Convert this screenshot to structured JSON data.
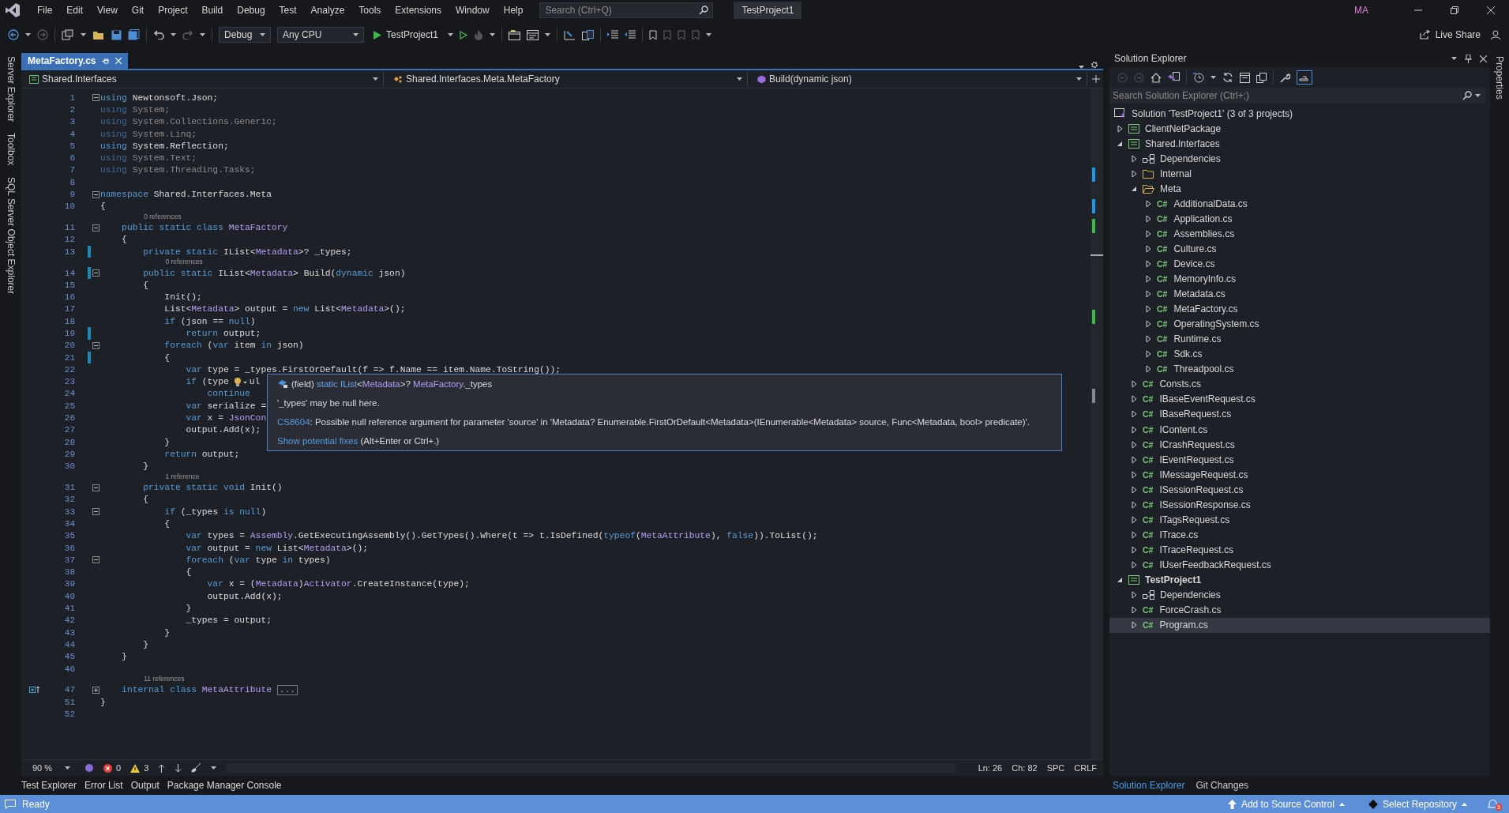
{
  "menu": [
    "File",
    "Edit",
    "View",
    "Git",
    "Project",
    "Build",
    "Debug",
    "Test",
    "Analyze",
    "Tools",
    "Extensions",
    "Window",
    "Help"
  ],
  "search": {
    "placeholder": "Search (Ctrl+Q)"
  },
  "solution_title": "TestProject1",
  "user_initials": "MA",
  "toolbar": {
    "configuration": "Debug",
    "platform": "Any CPU",
    "start_target": "TestProject1",
    "live_share": "Live Share"
  },
  "left_side_tabs": [
    "Server Explorer",
    "Toolbox",
    "SQL Server Object Explorer"
  ],
  "right_side_tabs": [
    "Properties"
  ],
  "document_tab": {
    "title": "MetaFactory.cs",
    "selected": true
  },
  "navigation": [
    "Shared.Interfaces",
    "Shared.Interfaces.Meta.MetaFactory",
    "Build(dynamic json)"
  ],
  "code_lines": [
    {
      "number": "1",
      "fold": {
        "expanded": true
      },
      "changed": false,
      "tokens": [
        {
          "text": "using",
          "kind": "kw"
        },
        {
          "text": " Newtonsoft.Json;",
          "kind": "tx"
        }
      ]
    },
    {
      "number": "2",
      "changed": false,
      "tokens": [
        {
          "text": "using",
          "kind": "kwd"
        },
        {
          "text": " System;",
          "kind": "dim"
        }
      ]
    },
    {
      "number": "3",
      "changed": false,
      "tokens": [
        {
          "text": "using",
          "kind": "kwd"
        },
        {
          "text": " System.Collections.Generic;",
          "kind": "dim"
        }
      ]
    },
    {
      "number": "4",
      "changed": false,
      "tokens": [
        {
          "text": "using",
          "kind": "kwd"
        },
        {
          "text": " System.Linq;",
          "kind": "dim"
        }
      ]
    },
    {
      "number": "5",
      "changed": false,
      "tokens": [
        {
          "text": "using",
          "kind": "kw"
        },
        {
          "text": " System.Reflection;",
          "kind": "tx"
        }
      ]
    },
    {
      "number": "6",
      "changed": false,
      "tokens": [
        {
          "text": "using",
          "kind": "kwd"
        },
        {
          "text": " System.Text;",
          "kind": "dim"
        }
      ]
    },
    {
      "number": "7",
      "changed": false,
      "tokens": [
        {
          "text": "using",
          "kind": "kwd"
        },
        {
          "text": " System.Threading.Tasks;",
          "kind": "dim"
        }
      ]
    },
    {
      "number": "8",
      "changed": false
    },
    {
      "number": "9",
      "fold": {
        "expanded": true
      },
      "changed": false,
      "tokens": [
        {
          "text": "namespace",
          "kind": "kw"
        },
        {
          "text": " Shared.Interfaces.Meta",
          "kind": "tx"
        }
      ]
    },
    {
      "number": "10",
      "changed": false,
      "tokens": [
        {
          "text": "{",
          "kind": "tx"
        }
      ]
    },
    {
      "number": "11",
      "fold": {
        "expanded": true
      },
      "changed": false,
      "lens": "0 references",
      "tokens": [
        {
          "text": "    public static class ",
          "kind": "kw"
        },
        {
          "text": "MetaFactory",
          "kind": "ty"
        }
      ]
    },
    {
      "number": "12",
      "changed": false,
      "tokens": [
        {
          "text": "    {",
          "kind": "tx"
        }
      ]
    },
    {
      "number": "13",
      "changed": true,
      "tokens": [
        {
          "text": "        private static",
          "kind": "kw"
        },
        {
          "text": " IList<",
          "kind": "tx"
        },
        {
          "text": "Metadata",
          "kind": "ty"
        },
        {
          "text": ">? _types;",
          "kind": "tx"
        }
      ]
    },
    {
      "number": "14",
      "fold": {
        "expanded": true
      },
      "changed": true,
      "lens": "0 references",
      "tokens": [
        {
          "text": "        public static",
          "kind": "kw"
        },
        {
          "text": " IList<",
          "kind": "tx"
        },
        {
          "text": "Metadata",
          "kind": "ty"
        },
        {
          "text": "> Build(",
          "kind": "tx"
        },
        {
          "text": "dynamic",
          "kind": "kw"
        },
        {
          "text": " json)",
          "kind": "tx"
        }
      ]
    },
    {
      "number": "15",
      "changed": false,
      "tokens": [
        {
          "text": "        {",
          "kind": "tx"
        }
      ]
    },
    {
      "number": "16",
      "changed": false,
      "tokens": [
        {
          "text": "            Init();",
          "kind": "tx"
        }
      ]
    },
    {
      "number": "17",
      "changed": false,
      "tokens": [
        {
          "text": "            List<",
          "kind": "tx"
        },
        {
          "text": "Metadata",
          "kind": "ty"
        },
        {
          "text": "> output = ",
          "kind": "tx"
        },
        {
          "text": "new",
          "kind": "kw"
        },
        {
          "text": " List<",
          "kind": "tx"
        },
        {
          "text": "Metadata",
          "kind": "ty"
        },
        {
          "text": ">();",
          "kind": "tx"
        }
      ]
    },
    {
      "number": "18",
      "changed": false,
      "tokens": [
        {
          "text": "            if",
          "kind": "kw"
        },
        {
          "text": " (json == ",
          "kind": "tx"
        },
        {
          "text": "null",
          "kind": "kw"
        },
        {
          "text": ")",
          "kind": "tx"
        }
      ]
    },
    {
      "number": "19",
      "changed": true,
      "tokens": [
        {
          "text": "                return",
          "kind": "kw"
        },
        {
          "text": " output;",
          "kind": "tx"
        }
      ]
    },
    {
      "number": "20",
      "fold": {
        "expanded": true
      },
      "changed": false,
      "tokens": [
        {
          "text": "            foreach",
          "kind": "kw"
        },
        {
          "text": " (",
          "kind": "tx"
        },
        {
          "text": "var",
          "kind": "kw"
        },
        {
          "text": " item ",
          "kind": "tx"
        },
        {
          "text": "in",
          "kind": "kw"
        },
        {
          "text": " json)",
          "kind": "tx"
        }
      ]
    },
    {
      "number": "21",
      "changed": true,
      "tokens": [
        {
          "text": "            {",
          "kind": "tx"
        }
      ]
    },
    {
      "number": "22",
      "changed": false,
      "tokens": [
        {
          "text": "                var",
          "kind": "kw"
        },
        {
          "text": " type = _types.FirstOrDefault(f => f.Name == item.Name.ToString());",
          "kind": "tx"
        }
      ]
    },
    {
      "number": "23",
      "changed": false,
      "tokens": [
        {
          "text": "                if",
          "kind": "kw"
        },
        {
          "text": " (type",
          "kind": "tx"
        },
        {
          "kind": "bulb"
        },
        {
          "text": "ul",
          "kind": "tx"
        }
      ]
    },
    {
      "number": "24",
      "changed": false,
      "tokens": [
        {
          "text": "                    continue",
          "kind": "kw"
        }
      ]
    },
    {
      "number": "25",
      "changed": false,
      "tokens": [
        {
          "text": "                var",
          "kind": "kw"
        },
        {
          "text": " serialize =",
          "kind": "tx"
        }
      ]
    },
    {
      "number": "26",
      "changed": false,
      "tokens": [
        {
          "text": "                var",
          "kind": "kw"
        },
        {
          "text": " x = ",
          "kind": "tx"
        },
        {
          "text": "JsonCon",
          "kind": "ty"
        }
      ]
    },
    {
      "number": "27",
      "changed": false,
      "tokens": [
        {
          "text": "                output.Add(x);",
          "kind": "tx"
        }
      ]
    },
    {
      "number": "28",
      "changed": false,
      "tokens": [
        {
          "text": "            }",
          "kind": "tx"
        }
      ]
    },
    {
      "number": "29",
      "changed": false,
      "tokens": [
        {
          "text": "            return",
          "kind": "kw"
        },
        {
          "text": " output;",
          "kind": "tx"
        }
      ]
    },
    {
      "number": "30",
      "changed": false,
      "tokens": [
        {
          "text": "        }",
          "kind": "tx"
        }
      ]
    },
    {
      "number": "31",
      "fold": {
        "expanded": true
      },
      "changed": false,
      "lens": "1 reference",
      "tokens": [
        {
          "text": "        private static void",
          "kind": "kw"
        },
        {
          "text": " Init()",
          "kind": "tx"
        }
      ]
    },
    {
      "number": "32",
      "changed": false,
      "tokens": [
        {
          "text": "        {",
          "kind": "tx"
        }
      ]
    },
    {
      "number": "33",
      "fold": {
        "expanded": true
      },
      "changed": false,
      "tokens": [
        {
          "text": "            if",
          "kind": "kw"
        },
        {
          "text": " (_types ",
          "kind": "tx"
        },
        {
          "text": "is null",
          "kind": "kw"
        },
        {
          "text": ")",
          "kind": "tx"
        }
      ]
    },
    {
      "number": "34",
      "changed": false,
      "tokens": [
        {
          "text": "            {",
          "kind": "tx"
        }
      ]
    },
    {
      "number": "35",
      "changed": false,
      "tokens": [
        {
          "text": "                var",
          "kind": "kw"
        },
        {
          "text": " types = ",
          "kind": "tx"
        },
        {
          "text": "Assembly",
          "kind": "ty"
        },
        {
          "text": ".GetExecutingAssembly().GetTypes().Where(t => t.IsDefined(",
          "kind": "tx"
        },
        {
          "text": "typeof",
          "kind": "kw"
        },
        {
          "text": "(",
          "kind": "tx"
        },
        {
          "text": "MetaAttribute",
          "kind": "ty"
        },
        {
          "text": "), ",
          "kind": "tx"
        },
        {
          "text": "false",
          "kind": "kw"
        },
        {
          "text": ")).ToList();",
          "kind": "tx"
        }
      ]
    },
    {
      "number": "36",
      "changed": false,
      "tokens": [
        {
          "text": "                var",
          "kind": "kw"
        },
        {
          "text": " output = ",
          "kind": "tx"
        },
        {
          "text": "new",
          "kind": "kw"
        },
        {
          "text": " List<",
          "kind": "tx"
        },
        {
          "text": "Metadata",
          "kind": "ty"
        },
        {
          "text": ">();",
          "kind": "tx"
        }
      ]
    },
    {
      "number": "37",
      "fold": {
        "expanded": true
      },
      "changed": false,
      "tokens": [
        {
          "text": "                foreach",
          "kind": "kw"
        },
        {
          "text": " (",
          "kind": "tx"
        },
        {
          "text": "var",
          "kind": "kw"
        },
        {
          "text": " type ",
          "kind": "tx"
        },
        {
          "text": "in",
          "kind": "kw"
        },
        {
          "text": " types)",
          "kind": "tx"
        }
      ]
    },
    {
      "number": "38",
      "changed": false,
      "tokens": [
        {
          "text": "                {",
          "kind": "tx"
        }
      ]
    },
    {
      "number": "39",
      "changed": false,
      "tokens": [
        {
          "text": "                    var",
          "kind": "kw"
        },
        {
          "text": " x = (",
          "kind": "tx"
        },
        {
          "text": "Metadata",
          "kind": "ty"
        },
        {
          "text": ")",
          "kind": "tx"
        },
        {
          "text": "Activator",
          "kind": "ty"
        },
        {
          "text": ".CreateInstance(type);",
          "kind": "tx"
        }
      ]
    },
    {
      "number": "40",
      "changed": false,
      "tokens": [
        {
          "text": "                    output.Add(x);",
          "kind": "tx"
        }
      ]
    },
    {
      "number": "41",
      "changed": false,
      "tokens": [
        {
          "text": "                }",
          "kind": "tx"
        }
      ]
    },
    {
      "number": "42",
      "changed": false,
      "tokens": [
        {
          "text": "                _types = output;",
          "kind": "tx"
        }
      ]
    },
    {
      "number": "43",
      "changed": false,
      "tokens": [
        {
          "text": "            }",
          "kind": "tx"
        }
      ]
    },
    {
      "number": "44",
      "changed": false,
      "tokens": [
        {
          "text": "        }",
          "kind": "tx"
        }
      ]
    },
    {
      "number": "45",
      "changed": false,
      "tokens": [
        {
          "text": "    }",
          "kind": "tx"
        }
      ]
    },
    {
      "number": "46",
      "changed": false
    },
    {
      "number": "47",
      "fold": {
        "expanded": false
      },
      "changed": false,
      "lens": "11 references",
      "glyph": {
        "kind": "implementation"
      },
      "tokens": [
        {
          "text": "    internal class ",
          "kind": "kw"
        },
        {
          "text": "MetaAttribute",
          "kind": "ty"
        },
        {
          "text": "...",
          "kind": "collapsed"
        }
      ]
    },
    {
      "number": "51",
      "changed": false,
      "tokens": [
        {
          "text": "}",
          "kind": "tx"
        }
      ]
    },
    {
      "number": "52",
      "changed": false
    }
  ],
  "tooltip": {
    "signature": [
      {
        "text": "(field) ",
        "kind": "tx"
      },
      {
        "text": "static IList",
        "kind": "kw"
      },
      {
        "text": "<",
        "kind": "tx"
      },
      {
        "text": "Metadata",
        "kind": "ty"
      },
      {
        "text": ">? ",
        "kind": "tx"
      },
      {
        "text": "MetaFactory",
        "kind": "ty"
      },
      {
        "text": "._types",
        "kind": "tx"
      }
    ],
    "message": "'_types' may be null here.",
    "error_code": "CS8604",
    "error_text": ": Possible null reference argument for parameter 'source' in 'Metadata? Enumerable.FirstOrDefault<Metadata>(IEnumerable<Metadata> source, Func<Metadata, bool> predicate)'.",
    "fix_link": "Show potential fixes",
    "fix_hint": "(Alt+Enter or Ctrl+.)"
  },
  "editor_status": {
    "zoom": "90 %",
    "errors": "0",
    "warnings": "3",
    "line": "Ln: 26",
    "column": "Ch: 82",
    "whitespace": "SPC",
    "line_ending": "CRLF"
  },
  "bottom_tabs": [
    "Test Explorer",
    "Error List",
    "Output",
    "Package Manager Console"
  ],
  "solution_explorer": {
    "title": "Solution Explorer",
    "search": {
      "placeholder": "Search Solution Explorer (Ctrl+;)"
    },
    "tree": [
      {
        "label": "Solution 'TestProject1' (3 of 3 projects)",
        "kind": "solution",
        "selected": false,
        "children": [
          {
            "label": "ClientNetPackage",
            "kind": "project",
            "startup": false,
            "expanded": false,
            "selected": false
          },
          {
            "label": "Shared.Interfaces",
            "kind": "project",
            "startup": false,
            "expanded": true,
            "selected": false,
            "children": [
              {
                "label": "Dependencies",
                "kind": "dependencies",
                "expanded": false,
                "selected": false
              },
              {
                "label": "Internal",
                "kind": "folder",
                "expanded": false,
                "selected": false
              },
              {
                "label": "Meta",
                "kind": "folder",
                "expanded": true,
                "selected": false,
                "children": [
                  {
                    "label": "AdditionalData.cs",
                    "kind": "file",
                    "badge": "C#",
                    "expanded": false,
                    "selected": false
                  },
                  {
                    "label": "Application.cs",
                    "kind": "file",
                    "badge": "C#",
                    "expanded": false,
                    "selected": false
                  },
                  {
                    "label": "Assemblies.cs",
                    "kind": "file",
                    "badge": "C#",
                    "expanded": false,
                    "selected": false
                  },
                  {
                    "label": "Culture.cs",
                    "kind": "file",
                    "badge": "C#",
                    "expanded": false,
                    "selected": false
                  },
                  {
                    "label": "Device.cs",
                    "kind": "file",
                    "badge": "C#",
                    "expanded": false,
                    "selected": false
                  },
                  {
                    "label": "MemoryInfo.cs",
                    "kind": "file",
                    "badge": "C#",
                    "expanded": false,
                    "selected": false
                  },
                  {
                    "label": "Metadata.cs",
                    "kind": "file",
                    "badge": "C#",
                    "expanded": false,
                    "selected": false
                  },
                  {
                    "label": "MetaFactory.cs",
                    "kind": "file",
                    "badge": "C#",
                    "expanded": false,
                    "selected": false
                  },
                  {
                    "label": "OperatingSystem.cs",
                    "kind": "file",
                    "badge": "C#",
                    "expanded": false,
                    "selected": false
                  },
                  {
                    "label": "Runtime.cs",
                    "kind": "file",
                    "badge": "C#",
                    "expanded": false,
                    "selected": false
                  },
                  {
                    "label": "Sdk.cs",
                    "kind": "file",
                    "badge": "C#",
                    "expanded": false,
                    "selected": false
                  },
                  {
                    "label": "Threadpool.cs",
                    "kind": "file",
                    "badge": "C#",
                    "expanded": false,
                    "selected": false
                  }
                ]
              },
              {
                "label": "Consts.cs",
                "kind": "file",
                "badge": "C#",
                "expanded": false,
                "selected": false
              },
              {
                "label": "IBaseEventRequest.cs",
                "kind": "file",
                "badge": "C#",
                "expanded": false,
                "selected": false
              },
              {
                "label": "IBaseRequest.cs",
                "kind": "file",
                "badge": "C#",
                "expanded": false,
                "selected": false
              },
              {
                "label": "IContent.cs",
                "kind": "file",
                "badge": "C#",
                "expanded": false,
                "selected": false
              },
              {
                "label": "ICrashRequest.cs",
                "kind": "file",
                "badge": "C#",
                "expanded": false,
                "selected": false
              },
              {
                "label": "IEventRequest.cs",
                "kind": "file",
                "badge": "C#",
                "expanded": false,
                "selected": false
              },
              {
                "label": "IMessageRequest.cs",
                "kind": "file",
                "badge": "C#",
                "expanded": false,
                "selected": false
              },
              {
                "label": "ISessionRequest.cs",
                "kind": "file",
                "badge": "C#",
                "expanded": false,
                "selected": false
              },
              {
                "label": "ISessionResponse.cs",
                "kind": "file",
                "badge": "C#",
                "expanded": false,
                "selected": false
              },
              {
                "label": "ITagsRequest.cs",
                "kind": "file",
                "badge": "C#",
                "expanded": false,
                "selected": false
              },
              {
                "label": "ITrace.cs",
                "kind": "file",
                "badge": "C#",
                "expanded": false,
                "selected": false
              },
              {
                "label": "ITraceRequest.cs",
                "kind": "file",
                "badge": "C#",
                "expanded": false,
                "selected": false
              },
              {
                "label": "IUserFeedbackRequest.cs",
                "kind": "file",
                "badge": "C#",
                "expanded": false,
                "selected": false
              }
            ]
          },
          {
            "label": "TestProject1",
            "kind": "project",
            "startup": true,
            "expanded": true,
            "selected": false,
            "children": [
              {
                "label": "Dependencies",
                "kind": "dependencies",
                "expanded": false,
                "selected": false
              },
              {
                "label": "ForceCrash.cs",
                "kind": "file",
                "badge": "C#",
                "expanded": false,
                "selected": false
              },
              {
                "label": "Program.cs",
                "kind": "file",
                "badge": "C#",
                "expanded": false,
                "selected": true
              }
            ]
          }
        ]
      }
    ]
  },
  "panel_tabs": [
    {
      "label": "Solution Explorer",
      "selected": true
    },
    {
      "label": "Git Changes",
      "selected": false
    }
  ],
  "status_bar": {
    "text": "Ready",
    "source_control": "Add to Source Control",
    "repository": "Select Repository",
    "notifications": "3"
  }
}
